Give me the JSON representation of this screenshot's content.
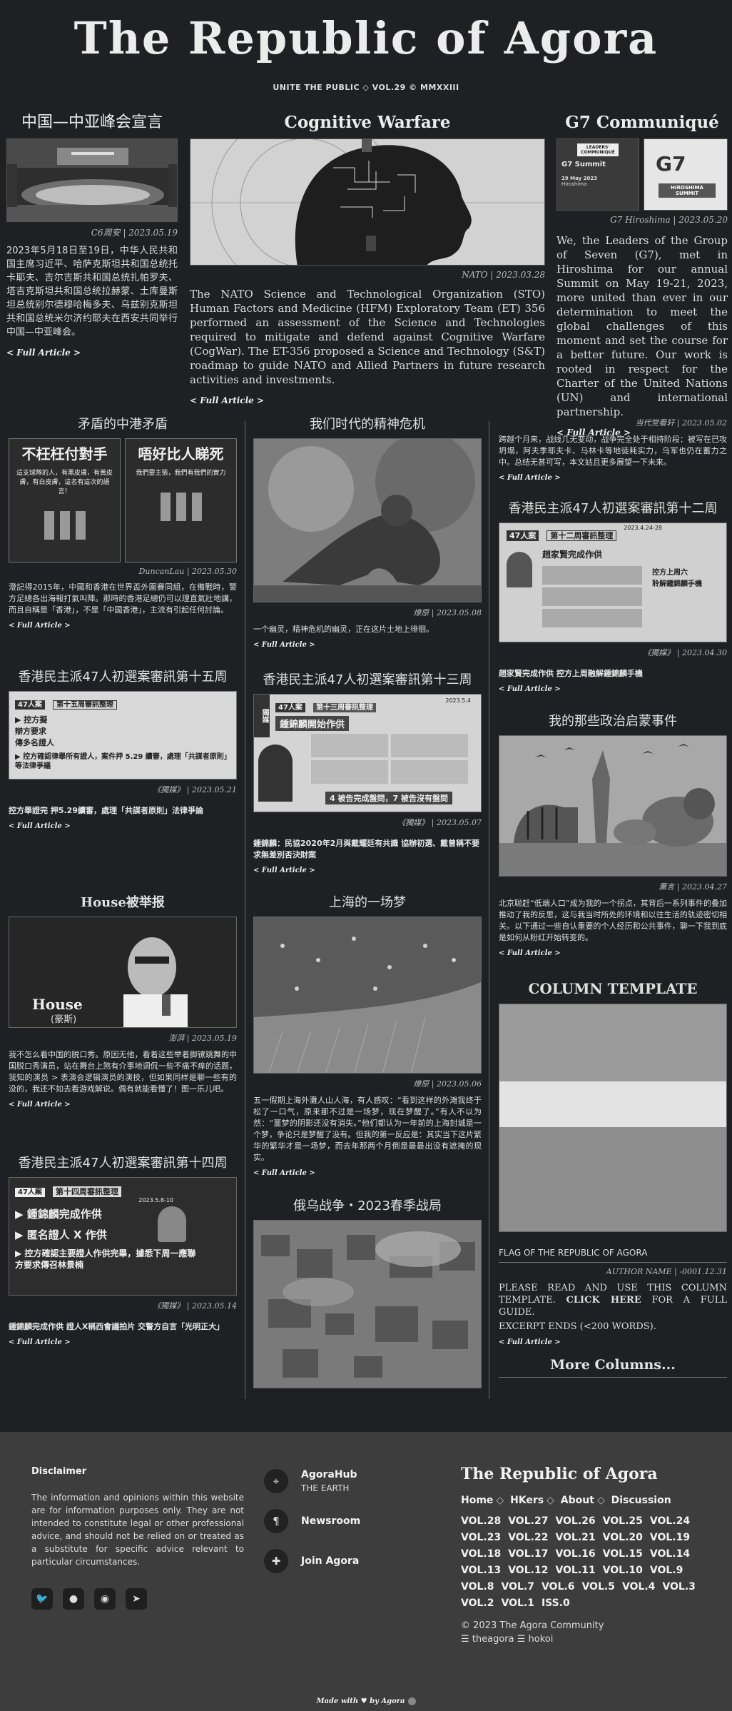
{
  "masthead": {
    "title": "The Republic of Agora",
    "subtitle": "UNITE THE PUBLIC ◇ VOL.29 © MMXXIII"
  },
  "top": {
    "left": {
      "title": "中国—中亚峰会宣言",
      "caption": "C6周安 | 2023.05.19",
      "body": "2023年5月18日至19日，中华人民共和国主席习近平、哈萨克斯坦共和国总统托卡耶夫、吉尔吉斯共和国总统扎帕罗夫、塔吉克斯坦共和国总统拉赫蒙、土库曼斯坦总统别尔德穆哈梅多夫、乌兹别克斯坦共和国总统米尔济约耶夫在西安共同举行中国—中亚峰会。",
      "more": "< Full Article >"
    },
    "center": {
      "title": "Cognitive Warfare",
      "caption": "NATO | 2023.03.28",
      "body": "The NATO Science and Technological Organization (STO) Human Factors and Medicine (HFM) Exploratory Team (ET) 356 performed an assessment of the Science and Technologies required to mitigate and defend against Cognitive Warfare (CogWar). The ET-356 proposed a Science and Technology (S&T) roadmap to guide NATO and Allied Partners in future research activities and investments.",
      "more": "< Full Article >"
    },
    "right": {
      "title": "G7 Communiqué",
      "caption": "G7 Hiroshima | 2023.05.20",
      "body": "We, the Leaders of the Group of Seven (G7), met in Hiroshima for our annual Summit on May 19-21, 2023, more united than ever in our determination to meet the global challenges of this moment and set the course for a better future. Our work is rooted in respect for the Charter of the United Nations (UN) and international partnership.",
      "more": "< Full Article >",
      "img_text": {
        "badge": "LEADERS' COMMUNIQUÉ",
        "summit": "G7 Summit",
        "date": "29 May 2023",
        "place": "Hiroshima",
        "logo": "G7",
        "logo_sub": "HIROSHIMA SUMMIT"
      }
    }
  },
  "grid": {
    "c1": [
      {
        "title": "矛盾的中港矛盾",
        "caption": "DuncanLau | 2023.05.30",
        "body": "澄記得2015年，中國和香港在世界盃外圍賽同組，在備戰時，警方足總各出海報打氣叫陣。那時的香港足總仍可以理直氣壯地講，而且自稱是「香港」，不是「中國香港」，主流有引起任何討論。",
        "more": "< Full Article >",
        "img_text": {
          "a1": "不枉枉付對手",
          "a2": "這支球隊的人，有黑皮膚，有黃皮膚，有白皮膚，這名有這次的語言！",
          "b1": "唔好比人睇死",
          "b2": "我們要主張，我們有我們的實力"
        }
      },
      {
        "title": "香港民主派47人初選案審訊第十五周",
        "caption": "《獨媒》 | 2023.05.21",
        "bold": "控方舉證完 押5.29續審，處理「共謀者原則」法律爭論",
        "more": "< Full Article >",
        "img_text": {
          "tag": "47人案",
          "week": "第十五周審訊整理",
          "l1": "▶ 控方擬",
          "l2": "辯方要求",
          "l3": "傳多名證人",
          "l4": "▶ 控方確認律舉所有證人，案件押 5.29 續審，處理「共謀者原則」等法律爭議"
        }
      },
      {
        "title": "House被举报",
        "caption": "澎湃 | 2023.05.19",
        "body": "我不怎么看中国的脱口秀。原因无他，看着这些举着脚镣跳舞的中国脱口秀演员，站在舞台上煞有介事地调侃一些不痛不痒的话题，我知的演员 > 表演会逻辑演员的演技，但如果同样是聊一些有的没的，我还不如去看游戏解说。偶有就能看懂了！图一乐儿吧。",
        "more": "< Full Article >",
        "img_text": {
          "name": "House",
          "sub": "(豪斯)"
        }
      },
      {
        "title": "香港民主派47人初選案審訊第十四周",
        "caption": "《獨媒》 | 2023.05.14",
        "bold": "鍾錦麟完成作供 證人X稱西會議拍片 交警方自言「光明正大」",
        "more": "< Full Article >",
        "img_text": {
          "tag": "47人案",
          "week": "第十四周審訊整理",
          "date": "2023.5.8-10",
          "l1": "▶ 鍾錦麟完成作供",
          "l2": "▶ 匿名證人 X 作供",
          "l3": "▶ 控方確認主要證人作供完畢，據悉下周一應聯方要求傳召林景楠"
        }
      }
    ],
    "c2": [
      {
        "title": "我们时代的精神危机",
        "caption": "燎原 | 2023.05.08",
        "body": "一个幽灵，精神危机的幽灵，正在这片土地上徘徊。",
        "more": "< Full Article >"
      },
      {
        "title": "香港民主派47人初選案審訊第十三周",
        "caption": "《獨媒》 | 2023.05.07",
        "bold": "鍾錦麟：民協2020年2月與戴耀廷有共識 協辦初選、戴曾稱不要求無差別否決財案",
        "more": "< Full Article >",
        "img_text": {
          "side": "獨媒",
          "tag": "47人案",
          "week": "第十三周審訊整理",
          "date": "2023.5.4",
          "l1": "鍾錦麟開始作供",
          "l2": "4 被告完成盤問，7 被告沒有盤問"
        }
      },
      {
        "title": "上海的一场梦",
        "caption": "燎原 | 2023.05.06",
        "body": "五一假期上海外灘人山人海，有人感叹：“看到这样的外滩我终于松了一口气，原来那不过是一场梦，现在梦醒了。”有人不以为然：“噩梦的阴影还没有消失。”他们都认为一年前的上海封城是一个梦，争论只是梦醒了没有。但我的第一反应是：其实当下这片繁华的繁华才是一场梦，而去年那两个月倒是最最出没有遮掩的现实。",
        "more": "< Full Article >"
      },
      {
        "title": "俄乌战争・2023春季战局"
      }
    ],
    "c3": [
      {
        "caption": "当代党看轩 | 2023.05.02",
        "body": "跨越个月来，战线几无变动，战争完全处于相持阶段：被写在已攻坍塌，阿夫季耶夫卡、马林卡等地徒耗实力，乌军也仍在蓄力之中。总结无甚可写，本文姑且更多展望一下未来。",
        "more": "< Full Article >"
      },
      {
        "title": "香港民主派47人初選案審訊第十二周",
        "caption": "《獨媒》 | 2023.04.30",
        "bold": "趙家賢完成作供 控方上周融解鍾錦麟手機",
        "more": "< Full Article >",
        "img_text": {
          "tag": "47人案",
          "week": "第十二周審訊整理",
          "date": "2023.4.24-28",
          "l1": "趙家賢完成作供",
          "l2": "控方上周六",
          "l3": "聆解鍾錦麟手機"
        }
      },
      {
        "title": "我的那些政治启蒙事件",
        "caption": "薰言 | 2023.04.27",
        "body": "北京聪赶“低端人口”成为我的一个拐点，其背后一系列事件的叠加推动了我的反思，这与我当时所处的环境和以往生活的轨迹密切相关。以下通过一些自认重要的个人经历和公共事件，聊一下我到底是如何从粉红开始转变的。",
        "more": "< Full Article >"
      },
      {
        "title": "COLUMN TEMPLATE",
        "flag_label": "FLAG OF THE REPUBLIC OF AGORA",
        "caption": "AUTHOR NAME | -0001.12.31",
        "body1": "PLEASE READ AND USE THIS COLUMN TEMPLATE.",
        "body_link": "CLICK HERE",
        "body2": "FOR A FULL GUIDE.",
        "body3": "EXCERPT ENDS (<200 WORDS).",
        "more": "< Full Article >"
      },
      {
        "more_columns": "More Columns..."
      }
    ]
  },
  "footer": {
    "disclaimer_title": "Disclaimer",
    "disclaimer": "The information and opinions within this website are for information purposes only. They are not intended to constitute legal or other professional advice, and should not be relied on or treated as a substitute for specific advice relevant to particular circumstances.",
    "social_icons": [
      "twitter-icon",
      "github-icon",
      "reddit-icon",
      "telegram-icon"
    ],
    "links": [
      {
        "title": "AgoraHub",
        "sub": "THE EARTH",
        "icon": "map-pin-icon"
      },
      {
        "title": "Newsroom",
        "sub": "",
        "icon": "paragraph-icon"
      },
      {
        "title": "Join Agora",
        "sub": "",
        "icon": "puzzle-icon"
      }
    ],
    "brand": "The Republic of Agora",
    "nav": [
      "Home",
      "HKers",
      "About",
      "Discussion"
    ],
    "volumes": [
      "VOL.28",
      "VOL.27",
      "VOL.26",
      "VOL.25",
      "VOL.24",
      "VOL.23",
      "VOL.22",
      "VOL.21",
      "VOL.20",
      "VOL.19",
      "VOL.18",
      "VOL.17",
      "VOL.16",
      "VOL.15",
      "VOL.14",
      "VOL.13",
      "VOL.12",
      "VOL.11",
      "VOL.10",
      "VOL.9",
      "VOL.8",
      "VOL.7",
      "VOL.6",
      "VOL.5",
      "VOL.4",
      "VOL.3",
      "VOL.2",
      "VOL.1",
      "ISS.0"
    ],
    "copyright": "© 2023 The Agora Community",
    "credits": "☰ theagora ☰ hokoi",
    "made_with": "Made with ♥ by Agora"
  }
}
